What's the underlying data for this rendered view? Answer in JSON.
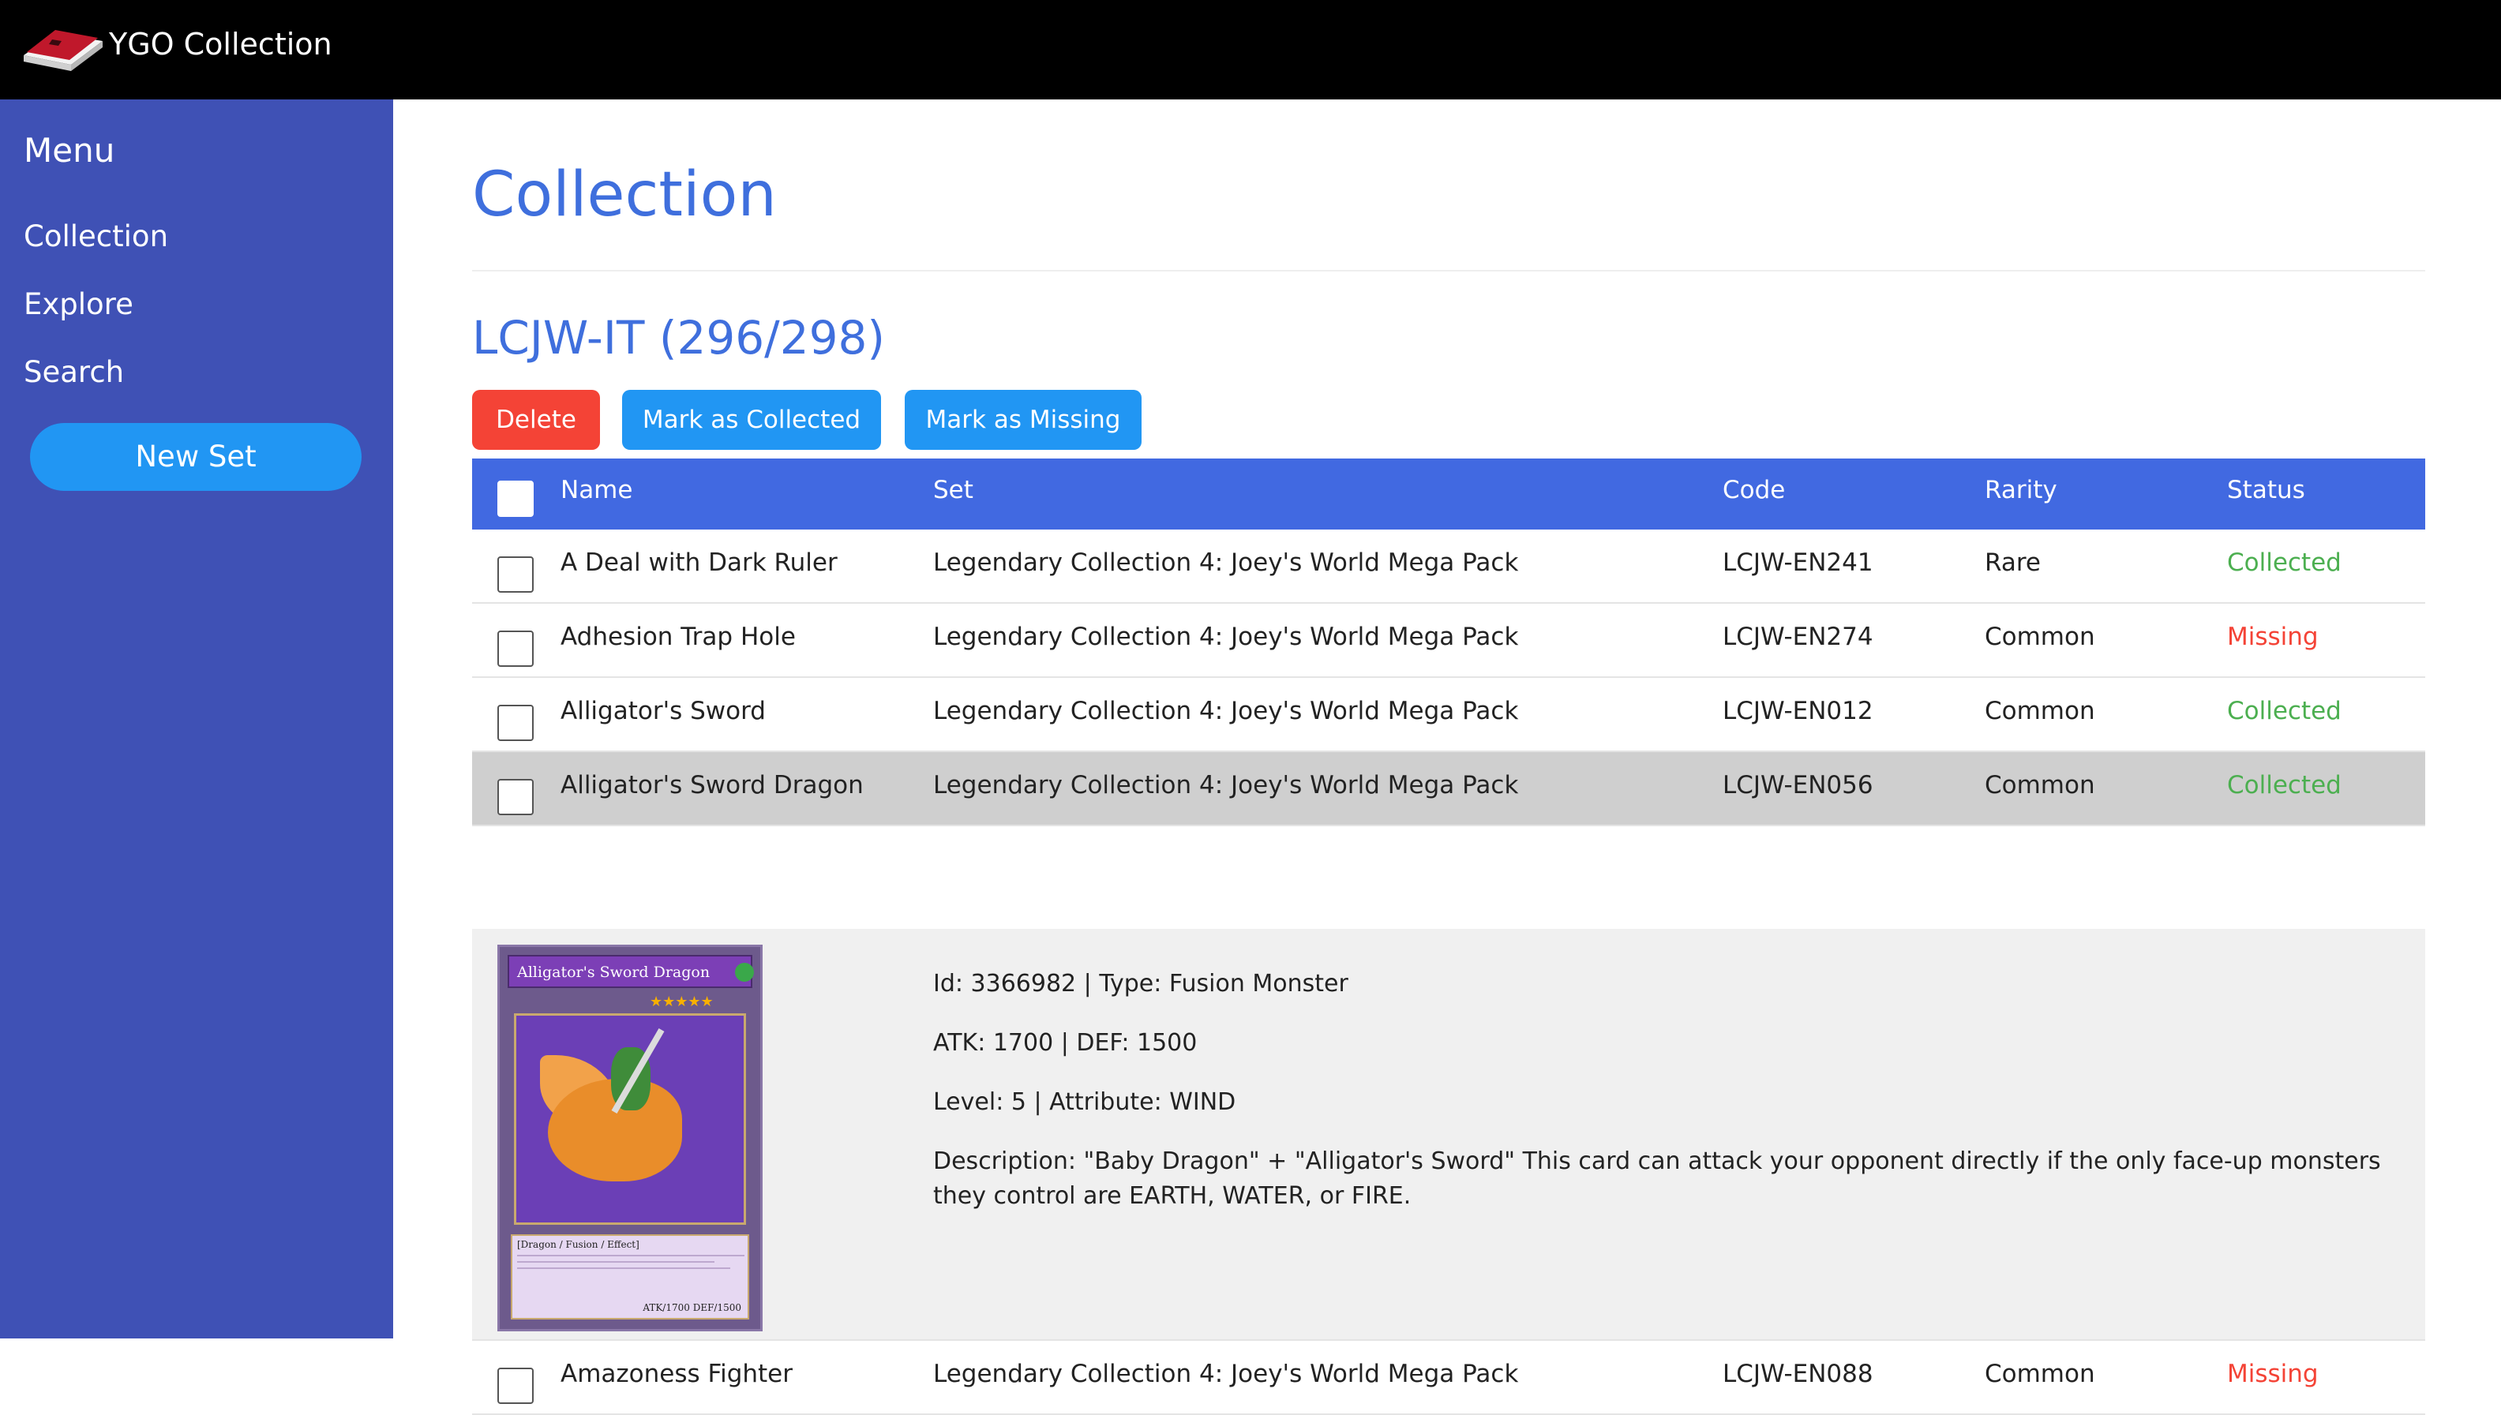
{
  "app": {
    "title": "YGO Collection",
    "logo_icon": "card-deck-logo-icon"
  },
  "sidebar": {
    "menu_title": "Menu",
    "items": [
      {
        "label": "Collection"
      },
      {
        "label": "Explore"
      },
      {
        "label": "Search"
      }
    ],
    "new_set_label": "New Set"
  },
  "main": {
    "page_title": "Collection",
    "set_title": "LCJW-IT (296/298)",
    "actions": {
      "delete_label": "Delete",
      "mark_collected_label": "Mark as Collected",
      "mark_missing_label": "Mark as Missing"
    },
    "table": {
      "columns": [
        "Name",
        "Set",
        "Code",
        "Rarity",
        "Status"
      ],
      "rows": [
        {
          "name": "A Deal with Dark Ruler",
          "set": "Legendary Collection 4: Joey's World Mega Pack",
          "code": "LCJW-EN241",
          "rarity": "Rare",
          "status": "Collected"
        },
        {
          "name": "Adhesion Trap Hole",
          "set": "Legendary Collection 4: Joey's World Mega Pack",
          "code": "LCJW-EN274",
          "rarity": "Common",
          "status": "Missing"
        },
        {
          "name": "Alligator's Sword",
          "set": "Legendary Collection 4: Joey's World Mega Pack",
          "code": "LCJW-EN012",
          "rarity": "Common",
          "status": "Collected"
        },
        {
          "name": "Alligator's Sword Dragon",
          "set": "Legendary Collection 4: Joey's World Mega Pack",
          "code": "LCJW-EN056",
          "rarity": "Common",
          "status": "Collected"
        },
        {
          "name": "Amazoness Fighter",
          "set": "Legendary Collection 4: Joey's World Mega Pack",
          "code": "LCJW-EN088",
          "rarity": "Common",
          "status": "Missing"
        }
      ]
    },
    "detail": {
      "line1": "Id: 3366982 | Type: Fusion Monster",
      "line2": "ATK: 1700 | DEF: 1500",
      "line3": "Level: 5 | Attribute: WIND",
      "line4": "Description: \"Baby Dragon\" + \"Alligator's Sword\" This card can attack your opponent directly if the only face-up monsters they control are EARTH, WATER, or FIRE.",
      "card": {
        "name": "Alligator's Sword Dragon",
        "stars": "★★★★★",
        "type_line": "[Dragon / Fusion / Effect]",
        "atk_def": "ATK/1700  DEF/1500"
      }
    }
  },
  "colors": {
    "topbar": "#000000",
    "sidebar": "#3f51b5",
    "accent": "#2196f3",
    "danger": "#f44336",
    "table_header": "#4169e1",
    "collected": "#4caf50",
    "missing": "#f44336"
  }
}
